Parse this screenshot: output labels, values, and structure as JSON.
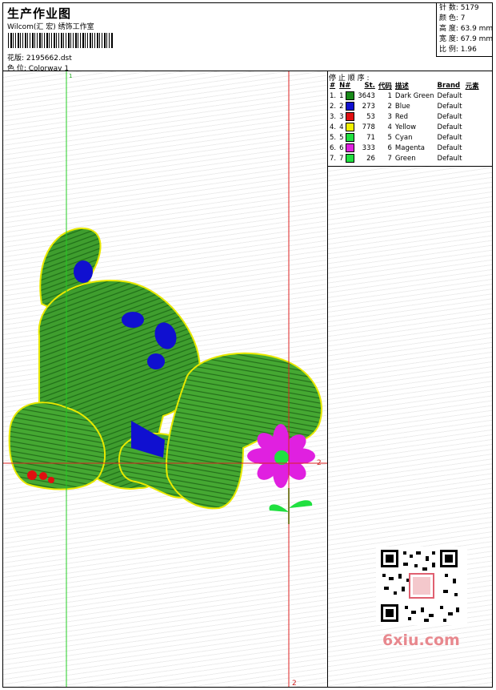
{
  "header": {
    "title": "生产作业图",
    "company": "Wilcom(汇 宏) 绣饰工作室",
    "design_label": "花版: 2195662.dst",
    "colorway_label": "色 位:  Colorway 1"
  },
  "stats": {
    "stitches": "针 数:  5179",
    "colors": "颜 色:  7",
    "height": "高 度:  63.9 mm",
    "width": "宽 度:  67.9 mm",
    "scale": "比 例:  1.96"
  },
  "stop_sequence": {
    "label": "停 止 顺 序 :",
    "headers": [
      "#",
      "N#",
      "St.",
      "代码",
      "描述",
      "Brand",
      "元素"
    ],
    "rows": [
      {
        "idx": "1.",
        "n": "1",
        "color": "#1a8a1a",
        "stitches": "3643",
        "code": "1",
        "desc": "Dark Green",
        "brand": "Default"
      },
      {
        "idx": "2.",
        "n": "2",
        "color": "#1010d0",
        "stitches": "273",
        "code": "2",
        "desc": "Blue",
        "brand": "Default"
      },
      {
        "idx": "3.",
        "n": "3",
        "color": "#e01010",
        "stitches": "53",
        "code": "3",
        "desc": "Red",
        "brand": "Default"
      },
      {
        "idx": "4.",
        "n": "4",
        "color": "#f0f000",
        "stitches": "778",
        "code": "4",
        "desc": "Yellow",
        "brand": "Default"
      },
      {
        "idx": "5.",
        "n": "5",
        "color": "#20e040",
        "stitches": "71",
        "code": "5",
        "desc": "Cyan",
        "brand": "Default"
      },
      {
        "idx": "6.",
        "n": "6",
        "color": "#e020e0",
        "stitches": "333",
        "code": "6",
        "desc": "Magenta",
        "brand": "Default"
      },
      {
        "idx": "7.",
        "n": "7",
        "color": "#20e040",
        "stitches": "26",
        "code": "7",
        "desc": "Green",
        "brand": "Default"
      }
    ]
  },
  "guides": {
    "v1_label": "1",
    "v2_label": "2",
    "h_label": "2"
  },
  "watermark": {
    "text": "6xiu.com"
  },
  "colors": {
    "guide_green": "#22cc22",
    "guide_red": "#dd2222",
    "fill_green": "#3a9a2a",
    "outline_yellow": "#e8e800"
  }
}
